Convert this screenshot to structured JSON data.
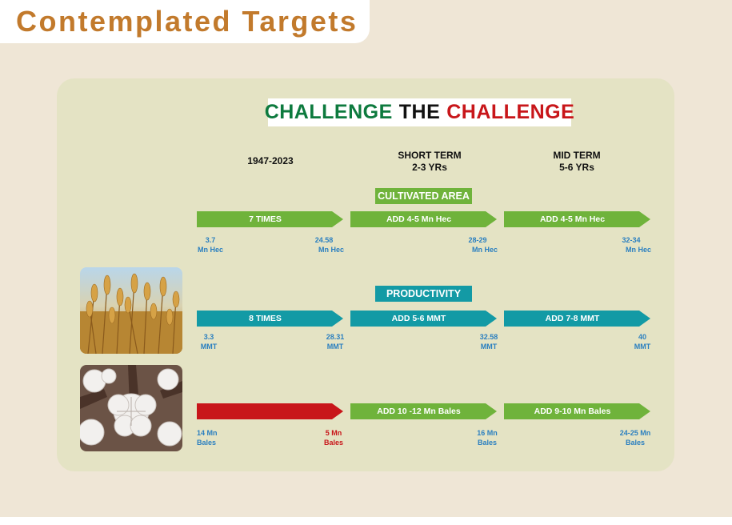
{
  "page": {
    "title": "Contemplated Targets"
  },
  "headline": {
    "part1": "CHALLENGE",
    "part2": "THE",
    "part3": "CHALLENGE",
    "colors": {
      "part1": "#0d7a3e",
      "part2": "#111111",
      "part3": "#c8161a"
    }
  },
  "columns": [
    {
      "line1": "1947-2023",
      "line2": ""
    },
    {
      "line1": "SHORT TERM",
      "line2": "2-3 YRs"
    },
    {
      "line1": "MID TERM",
      "line2": "5-6 YRs"
    }
  ],
  "sections": {
    "area": {
      "label": "CULTIVATED AREA",
      "arrows": [
        "7 TIMES",
        "ADD 4-5 Mn Hec",
        "ADD 4-5 Mn Hec"
      ],
      "values": [
        {
          "num": "3.7",
          "unit": "Mn Hec"
        },
        {
          "num": "24.58",
          "unit": "Mn Hec"
        },
        {
          "num": "28-29",
          "unit": "Mn Hec"
        },
        {
          "num": "32-34",
          "unit": "Mn Hec"
        }
      ]
    },
    "productivity": {
      "label": "PRODUCTIVITY",
      "arrows": [
        "8 TIMES",
        "ADD  5-6  MMT",
        "ADD 7-8  MMT"
      ],
      "values": [
        {
          "num": "3.3",
          "unit": "MMT"
        },
        {
          "num": "28.31",
          "unit": "MMT"
        },
        {
          "num": "32.58",
          "unit": "MMT"
        },
        {
          "num": "40",
          "unit": "MMT"
        }
      ]
    },
    "cotton": {
      "arrows": [
        "",
        "ADD 10 -12 Mn Bales",
        "ADD 9-10 Mn Bales"
      ],
      "values": [
        {
          "num": "14 Mn",
          "unit": "Bales"
        },
        {
          "num": "5 Mn",
          "unit": "Bales"
        },
        {
          "num": "16 Mn",
          "unit": "Bales"
        },
        {
          "num": "24-25 Mn",
          "unit": "Bales"
        }
      ]
    }
  },
  "colors": {
    "title": "#c27a2c",
    "green": "#6fb33b",
    "teal": "#139aa5",
    "red": "#c8161a",
    "value_text": "#2a7fc0"
  },
  "images": [
    {
      "icon": "wheat-photo"
    },
    {
      "icon": "cotton-photo"
    }
  ]
}
